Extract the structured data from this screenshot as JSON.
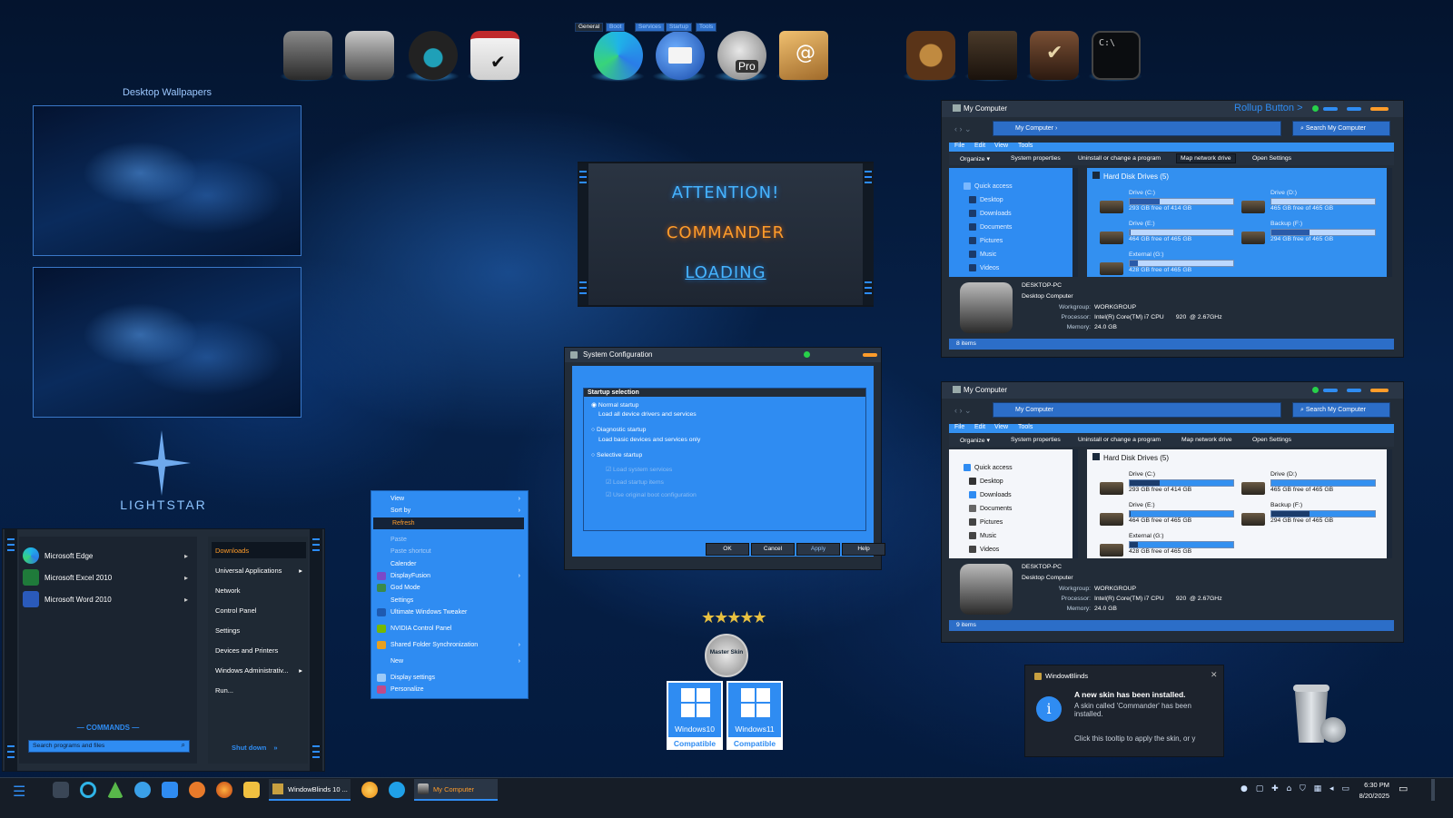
{
  "colors": {
    "accent": "#2f8cf2",
    "orange": "#ff9c2a",
    "window_bg": "#222c38",
    "title_bg": "#2a3646",
    "highlight": "#3390f0"
  },
  "dock": {
    "items": [
      "app-1",
      "app-2",
      "app-3",
      "checklist",
      "edge",
      "mail",
      "pro",
      "address-book",
      "settings-gear",
      "book",
      "checklist-2",
      "cmd"
    ],
    "pro_label": "Pro",
    "cmd_label": "C:\\"
  },
  "wallpapers": {
    "title": "Desktop Wallpapers"
  },
  "logo": {
    "text": "LIGHTSTAR"
  },
  "attention": {
    "line1": "ATTENTION!",
    "line2": "COMMANDER",
    "line3": "LOADING"
  },
  "start_menu": {
    "pinned": [
      {
        "label": "Microsoft Edge",
        "icon": "edge-icon"
      },
      {
        "label": "Microsoft Excel 2010",
        "icon": "excel-icon"
      },
      {
        "label": "Microsoft Word 2010",
        "icon": "word-icon"
      }
    ],
    "right_items": [
      {
        "label": "Downloads",
        "active": true,
        "arrow": false
      },
      {
        "label": "Universal Applications",
        "active": false,
        "arrow": true
      },
      {
        "label": "Network",
        "active": false,
        "arrow": false
      },
      {
        "label": "Control Panel",
        "active": false,
        "arrow": false
      },
      {
        "label": "Settings",
        "active": false,
        "arrow": false
      },
      {
        "label": "Devices and Printers",
        "active": false,
        "arrow": false
      },
      {
        "label": "Windows Administrativ...",
        "active": false,
        "arrow": true
      },
      {
        "label": "Run...",
        "active": false,
        "arrow": false
      }
    ],
    "commands_label": "— COMMANDS —",
    "search_placeholder": "Search programs and files",
    "shutdown_label": "Shut down"
  },
  "system_config": {
    "title": "System Configuration",
    "tabs": [
      "General",
      "Boot",
      "Services",
      "Startup",
      "Tools"
    ],
    "group_title": "Startup selection",
    "normal": "Normal startup",
    "normal_desc": "Load all device drivers and services",
    "diagnostic": "Diagnostic startup",
    "diagnostic_desc": "Load basic devices and services only",
    "selective": "Selective startup",
    "sub_options": [
      "Load system services",
      "Load startup items",
      "Use original boot configuration"
    ],
    "buttons": [
      "OK",
      "Cancel",
      "Apply",
      "Help"
    ]
  },
  "context_menu": {
    "items": [
      {
        "label": "View",
        "arrow": true,
        "state": "normal",
        "icon": ""
      },
      {
        "label": "Sort by",
        "arrow": true,
        "state": "normal",
        "icon": ""
      },
      {
        "label": "Refresh",
        "arrow": false,
        "state": "highlight",
        "icon": ""
      },
      {
        "label": "Paste",
        "arrow": false,
        "state": "disabled",
        "icon": ""
      },
      {
        "label": "Paste shortcut",
        "arrow": false,
        "state": "disabled",
        "icon": ""
      },
      {
        "label": "Calender",
        "arrow": false,
        "state": "normal",
        "icon": ""
      },
      {
        "label": "DisplayFusion",
        "arrow": true,
        "state": "normal",
        "icon": "displayfusion-icon"
      },
      {
        "label": "God Mode",
        "arrow": false,
        "state": "normal",
        "icon": "god-mode-icon"
      },
      {
        "label": "Settings",
        "arrow": false,
        "state": "normal",
        "icon": ""
      },
      {
        "label": "Ultimate Windows Tweaker",
        "arrow": false,
        "state": "normal",
        "icon": "tweaker-icon"
      },
      {
        "label": "NVIDIA Control Panel",
        "arrow": false,
        "state": "normal",
        "icon": "nvidia-icon"
      },
      {
        "label": "Shared Folder Synchronization",
        "arrow": true,
        "state": "normal",
        "icon": "sync-icon"
      },
      {
        "label": "New",
        "arrow": true,
        "state": "normal",
        "icon": ""
      },
      {
        "label": "Display settings",
        "arrow": false,
        "state": "normal",
        "icon": "display-icon"
      },
      {
        "label": "Personalize",
        "arrow": false,
        "state": "normal",
        "icon": "personalize-icon"
      }
    ]
  },
  "explorer_1": {
    "title": "My Computer",
    "rollup": "Rollup Button >",
    "address": "My Computer",
    "search": "Search My Computer",
    "menu": [
      "File",
      "Edit",
      "View",
      "Tools"
    ],
    "toolbar": [
      "Organize ▾",
      "System properties",
      "Uninstall or change a program",
      "Map network drive",
      "Open Settings"
    ],
    "nav": [
      "Quick access",
      "Desktop",
      "Downloads",
      "Documents",
      "Pictures",
      "Music",
      "Videos"
    ],
    "group": "Hard Disk Drives (5)",
    "drives": [
      {
        "name": "Drive (C:)",
        "free": "293 GB free of 414 GB",
        "used": 0.29
      },
      {
        "name": "Drive (D:)",
        "free": "465 GB free of 465 GB",
        "used": 0.0
      },
      {
        "name": "Drive (E:)",
        "free": "464 GB free of 465 GB",
        "used": 0.01
      },
      {
        "name": "Backup (F:)",
        "free": "294 GB free of 465 GB",
        "used": 0.37
      },
      {
        "name": "External (G:)",
        "free": "428 GB free of 465 GB",
        "used": 0.08
      }
    ],
    "computer_name": "DESKTOP-PC",
    "computer_type": "Desktop Computer",
    "workgroup_label": "Workgroup:",
    "workgroup": "WORKGROUP",
    "processor_label": "Processor:",
    "processor": "Intel(R) Core(TM) i7 CPU       920  @ 2.67GHz",
    "memory_label": "Memory:",
    "memory": "24.0 GB",
    "status": "8 items"
  },
  "explorer_2": {
    "title": "My Computer",
    "address": "My Computer",
    "search": "Search My Computer",
    "menu": [
      "File",
      "Edit",
      "View",
      "Tools"
    ],
    "toolbar": [
      "Organize ▾",
      "System properties",
      "Uninstall or change a program",
      "Map network drive",
      "Open Settings"
    ],
    "nav": [
      "Quick access",
      "Desktop",
      "Downloads",
      "Documents",
      "Pictures",
      "Music",
      "Videos"
    ],
    "group": "Hard Disk Drives (5)",
    "drives": [
      {
        "name": "Drive (C:)",
        "free": "293 GB free of 414 GB",
        "used": 0.29
      },
      {
        "name": "Drive (D:)",
        "free": "465 GB free of 465 GB",
        "used": 0.0
      },
      {
        "name": "Drive (E:)",
        "free": "464 GB free of 465 GB",
        "used": 0.01
      },
      {
        "name": "Backup (F:)",
        "free": "294 GB free of 465 GB",
        "used": 0.37
      },
      {
        "name": "External (G:)",
        "free": "428 GB free of 465 GB",
        "used": 0.08
      }
    ],
    "computer_name": "DESKTOP-PC",
    "computer_type": "Desktop Computer",
    "workgroup_label": "Workgroup:",
    "workgroup": "WORKGROUP",
    "processor_label": "Processor:",
    "processor": "Intel(R) Core(TM) i7 CPU       920  @ 2.67GHz",
    "memory_label": "Memory:",
    "memory": "24.0 GB",
    "status": "9 items"
  },
  "badges": {
    "stars": "★★★★★",
    "master_skin": "Master Skin",
    "win10": "Windows10",
    "win11": "Windows11",
    "compatible": "Compatible"
  },
  "notification": {
    "app": "WindowBlinds",
    "title": "A new skin has been installed.",
    "body": "A skin called 'Commander' has been installed.",
    "hint": "Click this tooltip to apply the skin, or y"
  },
  "taskbar": {
    "task1": "WindowBlinds 10 ...",
    "task2": "My Computer",
    "time": "6:30 PM",
    "date": "8/20/2025"
  }
}
